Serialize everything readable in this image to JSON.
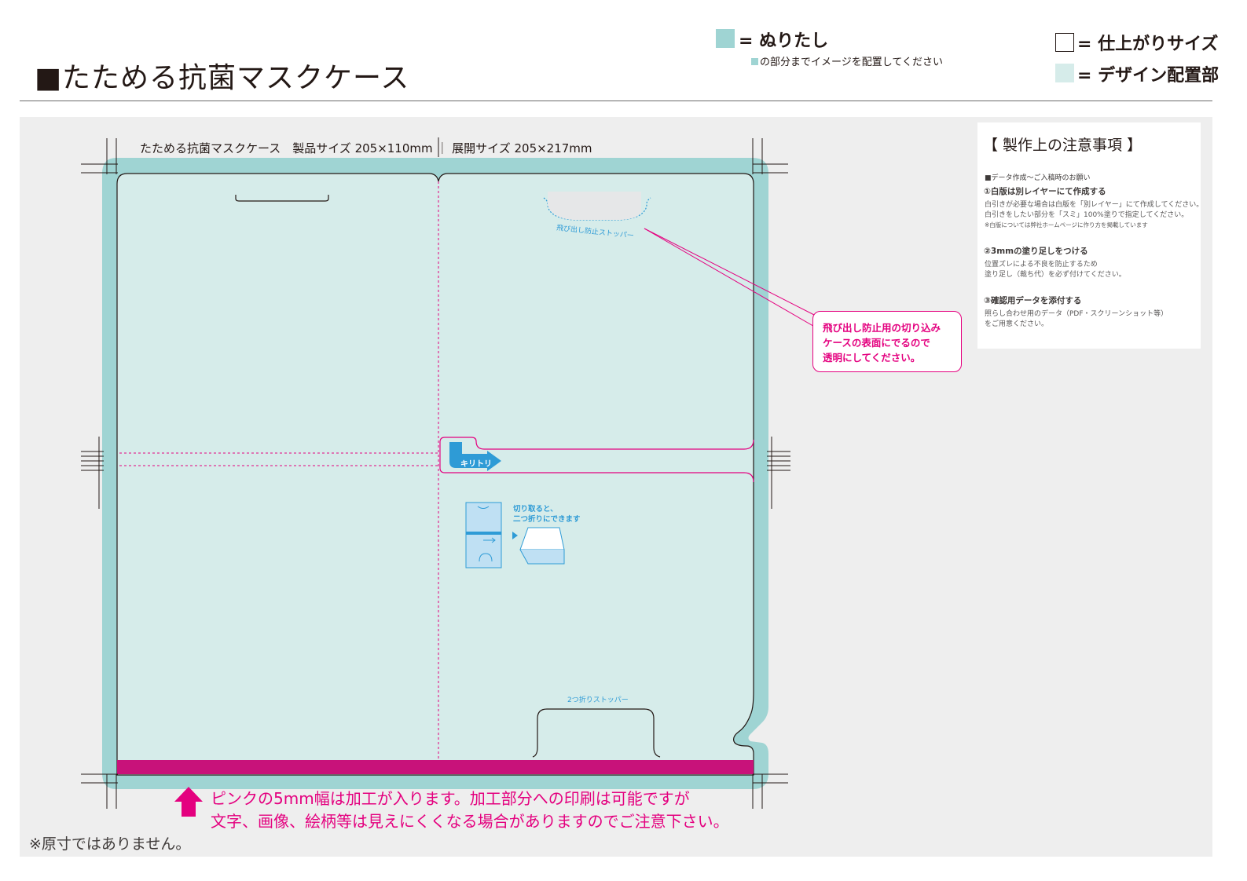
{
  "header": {
    "title": "■たためる抗菌マスクケース"
  },
  "legend": {
    "bleed_label": "= ぬりたし",
    "bleed_note": "の部分までイメージを配置してください",
    "trim_label": "= 仕上がりサイズ",
    "design_label": "= デザイン配置部",
    "colors": {
      "bleed": "#9fd4d3",
      "design": "#d6ecea",
      "process": "#c8127a",
      "accent": "#e4007f",
      "guide_blue": "#2e9bd6"
    }
  },
  "template": {
    "spec": "たためる抗菌マスクケース　製品サイズ 205×110mm ｜ 展開サイズ 205×217mm",
    "stopper_top_label": "飛び出し防止ストッパー",
    "tear_label": "キリトリ",
    "fold_note_line1": "切り取ると、",
    "fold_note_line2": "二つ折りにできます",
    "stopper_bottom_label": "2つ折りストッパー"
  },
  "callout": {
    "line1": "飛び出し防止用の切り込み",
    "line2": "ケースの表面にでるので",
    "line3": "透明にしてください。"
  },
  "notes": {
    "title": "【 製作上の注意事項 】",
    "intro": "■データ作成〜ご入稿時のお願い",
    "item1_title": "①白版は別レイヤーにて作成する",
    "item1_line1": "白引きが必要な場合は白版を「別レイヤー」にて作成してください。",
    "item1_line2": "白引きをしたい部分を「スミ」100%塗りで指定してください。",
    "item1_line3": "※白版については弊社ホームページに作り方を掲載しています",
    "item2_title": "②3mmの塗り足しをつける",
    "item2_line1": "位置ズレによる不良を防止するため",
    "item2_line2": "塗り足し（裁ち代）を必ず付けてください。",
    "item3_title": "③確認用データを添付する",
    "item3_line1": "照らし合わせ用のデータ（PDF・スクリーンショット等）",
    "item3_line2": "をご用意ください。"
  },
  "warning": {
    "line1": "ピンクの5mm幅は加工が入ります。加工部分への印刷は可能ですが",
    "line2": "文字、画像、絵柄等は見えにくくなる場合がありますのでご注意下さい。"
  },
  "footnote": "※原寸ではありません。"
}
